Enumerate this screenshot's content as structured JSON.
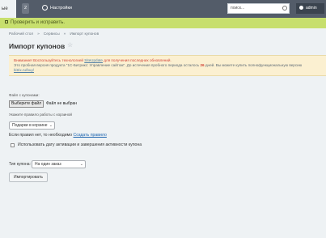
{
  "topbar": {
    "home_tab": "ые",
    "notifications": "2",
    "settings": "Настройки",
    "search_placeholder": "поиск...",
    "user": "admin"
  },
  "panel": {
    "text": "Проверить и исправить."
  },
  "breadcrumb": [
    "Рабочий стол",
    "Сервисы",
    "Импорт купонов"
  ],
  "page_title": "Импорт купонов",
  "warning": {
    "line1": "Внимание! Воспользуйтесь технологией",
    "link1": "SiteUpdate",
    "line1_end": "для получения последних обновлений.",
    "line2_start": "Это пробная версия продукта \"1С-Битрикс: Управление сайтом\". До истечения пробного периода осталось",
    "days": "26",
    "line2_end": "дней. Вы можете купить полнофункциональную версию",
    "link2": "bitrix.ru/buy/"
  },
  "form": {
    "file_label": "Файл с купонами:",
    "file_button": "Выберите файл",
    "file_status": "Файл не выбран",
    "rule_label": "Укажите правило работы с корзиной",
    "rule_value": "Подарки в корзине",
    "no_rule_text": "Если правил нет, то необходимо",
    "create_rule_link": "Создать правило",
    "checkbox_label": "Использовать дату активации и завершения активности купона",
    "coupon_type_label": "Тип купона:",
    "coupon_type_value": "На один заказ",
    "import_button": "Импортировать"
  }
}
